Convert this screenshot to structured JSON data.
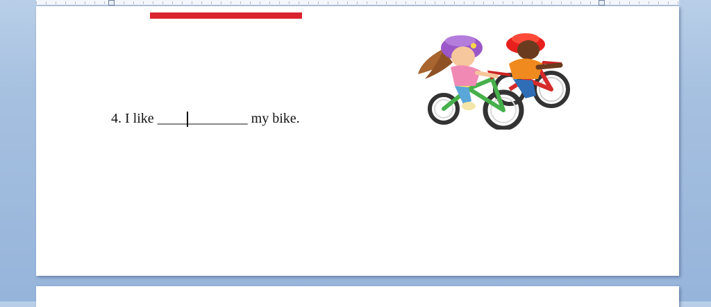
{
  "document": {
    "sentence": {
      "number": "4.",
      "before": "I like",
      "blank": "_____________",
      "after": "my bike."
    },
    "illustration": "kids-riding-bikes"
  },
  "colors": {
    "header_bar": "#d9232e",
    "workspace_background": "#a6c0e0",
    "page_background": "#ffffff"
  }
}
